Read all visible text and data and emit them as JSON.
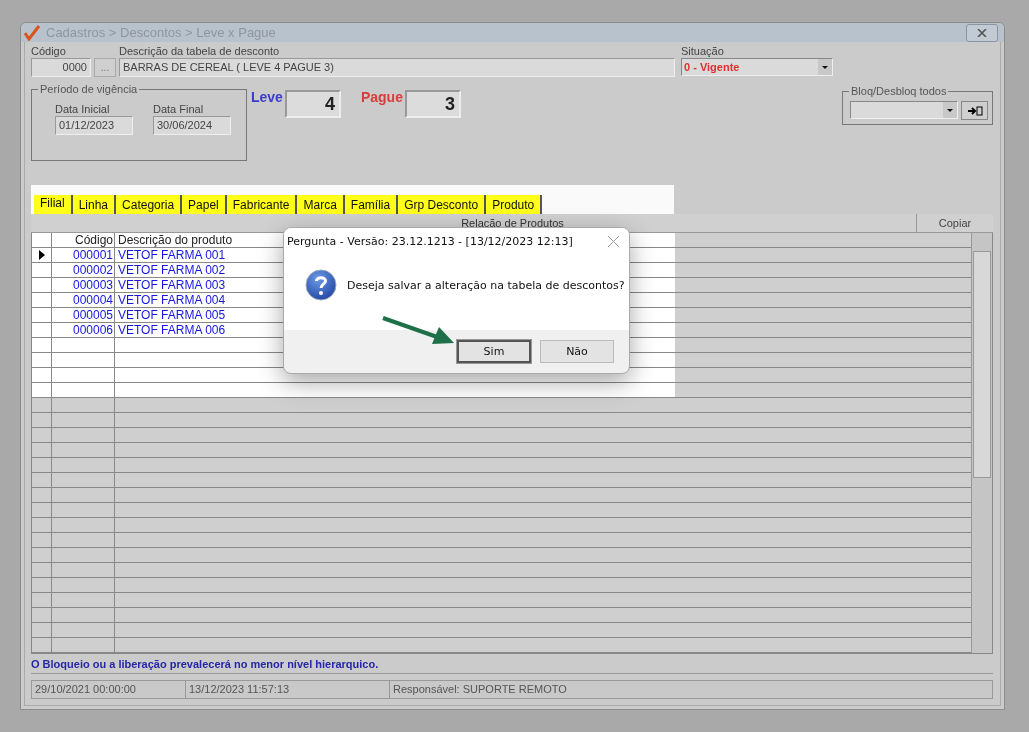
{
  "window": {
    "title": "Cadastros > Descontos > Leve x Pague"
  },
  "form": {
    "codigo_label": "Código",
    "codigo_value": "0000",
    "lookup_button": "...",
    "descricao_label": "Descrição da tabela de desconto",
    "descricao_value": "BARRAS DE CEREAL ( LEVE 4 PAGUE 3)",
    "situacao_label": "Situação",
    "situacao_value": "0 - Vigente"
  },
  "periodo": {
    "legend": "Período de vigência",
    "data_inicial_label": "Data Inicial",
    "data_inicial": "01/12/2023",
    "data_final_label": "Data Final",
    "data_final": "30/06/2024"
  },
  "leve": {
    "label": "Leve",
    "value": "4"
  },
  "pague": {
    "label": "Pague",
    "value": "3"
  },
  "bloq": {
    "legend": "Bloq/Desbloq todos"
  },
  "tabs": [
    {
      "label": "Filial",
      "selected": true
    },
    {
      "label": "Linha",
      "selected": false
    },
    {
      "label": "Categoria",
      "selected": false
    },
    {
      "label": "Papel",
      "selected": false
    },
    {
      "label": "Fabricante",
      "selected": false
    },
    {
      "label": "Marca",
      "selected": false
    },
    {
      "label": "Família",
      "selected": false
    },
    {
      "label": "Grp Desconto",
      "selected": false
    },
    {
      "label": "Produto",
      "selected": false
    }
  ],
  "grid": {
    "title": "Relação de Produtos",
    "copy_button": "Copiar",
    "columns": [
      "Código",
      "Descrição do produto"
    ],
    "rows": [
      {
        "code": "000001",
        "description": "VETOF FARMA 001",
        "selected": true
      },
      {
        "code": "000002",
        "description": "VETOF FARMA 002",
        "selected": false
      },
      {
        "code": "000003",
        "description": "VETOF FARMA 003",
        "selected": false
      },
      {
        "code": "000004",
        "description": "VETOF FARMA 004",
        "selected": false
      },
      {
        "code": "000005",
        "description": "VETOF FARMA 005",
        "selected": false
      },
      {
        "code": "000006",
        "description": "VETOF FARMA 006",
        "selected": false
      }
    ]
  },
  "hint": "O Bloqueio ou a liberação prevalecerá no menor nível hierarquico.",
  "status_bar": [
    "29/10/2021 00:00:00",
    "13/12/2023 11:57:13",
    "Responsável: SUPORTE REMOTO"
  ],
  "dialog": {
    "title": "Pergunta - Versão: 23.12.1213 - [13/12/2023 12:13]",
    "message": "Deseja salvar a alteração na tabela de descontos?",
    "buttons": [
      {
        "label": "Sim",
        "default": true
      },
      {
        "label": "Não",
        "default": false
      }
    ]
  }
}
